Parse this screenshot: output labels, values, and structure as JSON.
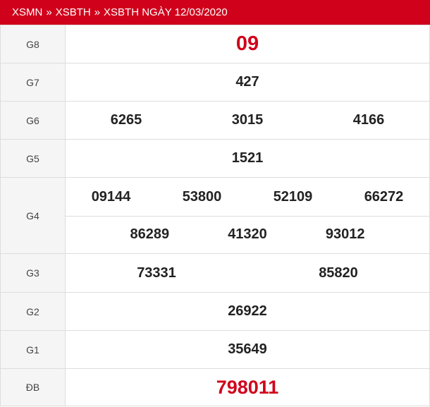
{
  "breadcrumb": {
    "items": [
      "XSMN",
      "XSBTH",
      "XSBTH NGÀY 12/03/2020"
    ],
    "separator": "»"
  },
  "colors": {
    "accent": "#d0021b",
    "label_bg": "#f5f5f5",
    "border": "#dddddd"
  },
  "prizes": {
    "g8": {
      "label": "G8",
      "values": [
        "09"
      ]
    },
    "g7": {
      "label": "G7",
      "values": [
        "427"
      ]
    },
    "g6": {
      "label": "G6",
      "values": [
        "6265",
        "3015",
        "4166"
      ]
    },
    "g5": {
      "label": "G5",
      "values": [
        "1521"
      ]
    },
    "g4": {
      "label": "G4",
      "row1": [
        "09144",
        "53800",
        "52109",
        "66272"
      ],
      "row2": [
        "86289",
        "41320",
        "93012"
      ]
    },
    "g3": {
      "label": "G3",
      "values": [
        "73331",
        "85820"
      ]
    },
    "g2": {
      "label": "G2",
      "values": [
        "26922"
      ]
    },
    "g1": {
      "label": "G1",
      "values": [
        "35649"
      ]
    },
    "db": {
      "label": "ĐB",
      "values": [
        "798011"
      ]
    }
  }
}
